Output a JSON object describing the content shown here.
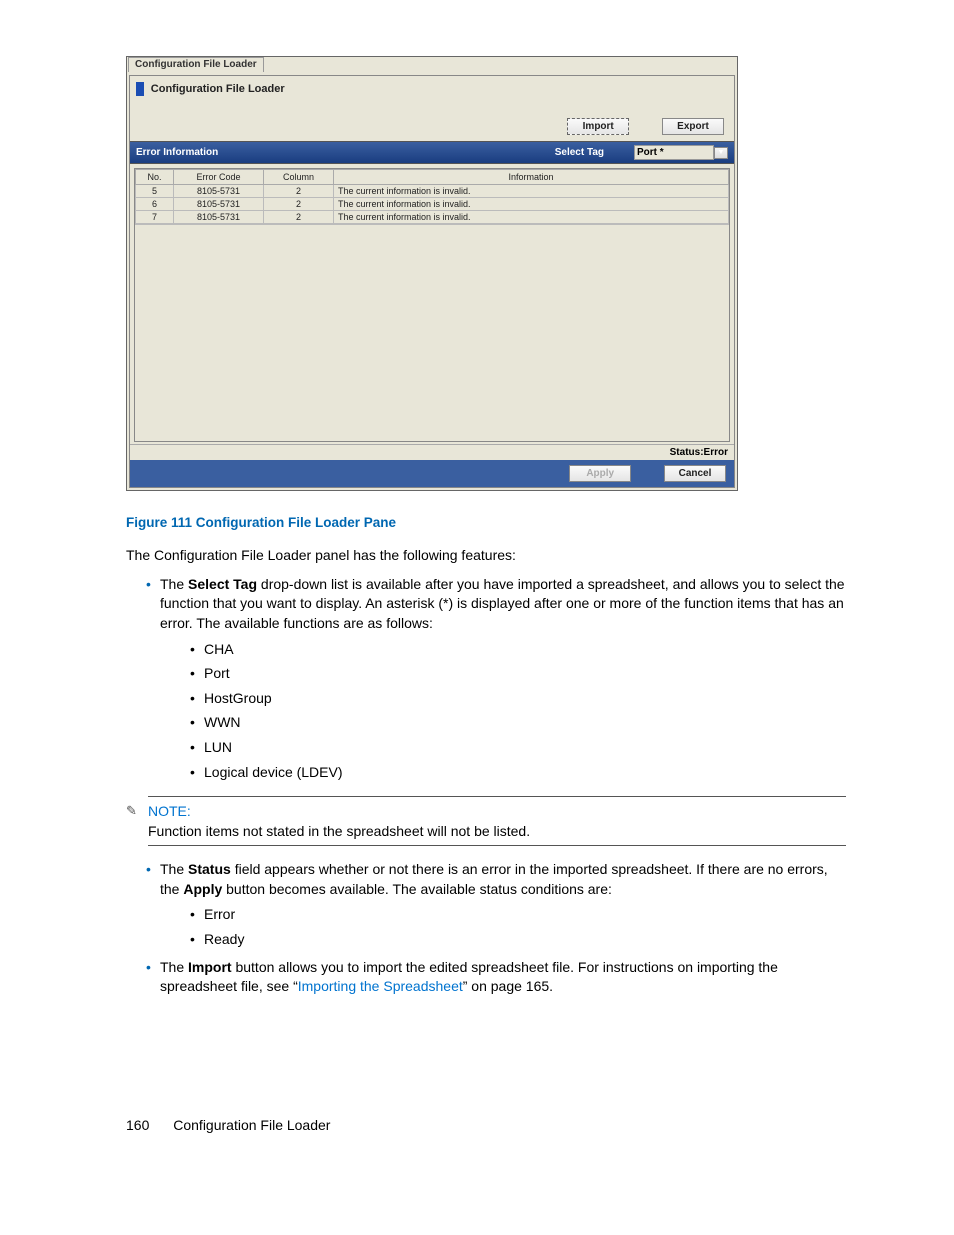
{
  "panel": {
    "tab": "Configuration File Loader",
    "title": "Configuration File Loader",
    "buttons": {
      "import": "Import",
      "export": "Export",
      "apply": "Apply",
      "cancel": "Cancel"
    },
    "section_label": "Error Information",
    "select_tag_label": "Select Tag",
    "select_value": "Port  *",
    "columns": {
      "no": "No.",
      "err": "Error Code",
      "col": "Column",
      "info": "Information"
    },
    "rows": [
      {
        "no": "5",
        "err": "8105-5731",
        "col": "2",
        "info": "The current  information is invalid."
      },
      {
        "no": "6",
        "err": "8105-5731",
        "col": "2",
        "info": "The current  information is invalid."
      },
      {
        "no": "7",
        "err": "8105-5731",
        "col": "2",
        "info": "The current  information is invalid."
      }
    ],
    "status": "Status:Error"
  },
  "caption": "Figure 111 Configuration File Loader Pane",
  "intro": "The Configuration File Loader panel has the following features:",
  "bullet1_pre": "The ",
  "bullet1_bold": "Select Tag",
  "bullet1_post": " drop-down list is available after you have imported a spreadsheet, and allows you to select the function that you want to display. An asterisk (*) is displayed after one or more of the function items that has an error. The available functions are as follows:",
  "funcs": {
    "a": "CHA",
    "b": "Port",
    "c": "HostGroup",
    "d": "WWN",
    "e": "LUN",
    "f": "Logical device (LDEV)"
  },
  "note": {
    "head": "NOTE:",
    "body": "Function items not stated in the spreadsheet will not be listed."
  },
  "bullet2_pre": "The ",
  "bullet2_b1": "Status",
  "bullet2_mid": " field appears whether or not there is an error in the imported spreadsheet. If there are no errors, the ",
  "bullet2_b2": "Apply",
  "bullet2_post": " button becomes available. The available status conditions are:",
  "statuses": {
    "a": "Error",
    "b": "Ready"
  },
  "bullet3_pre": "The ",
  "bullet3_b": "Import",
  "bullet3_mid": " button allows you to import the edited spreadsheet file. For instructions on importing the spreadsheet file, see “",
  "bullet3_link": "Importing the Spreadsheet",
  "bullet3_post": "” on page 165.",
  "footer": {
    "page": "160",
    "title": "Configuration File Loader"
  }
}
